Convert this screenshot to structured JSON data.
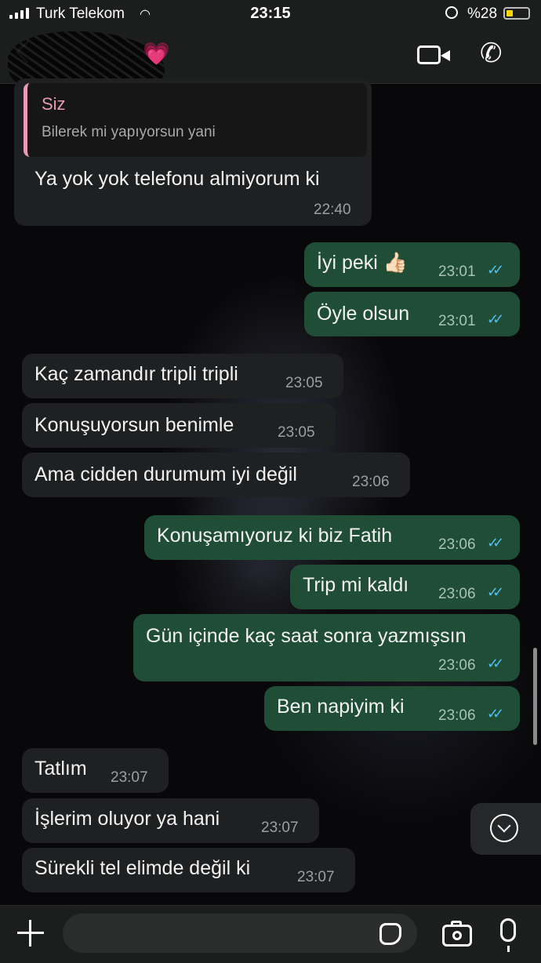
{
  "status_bar": {
    "carrier": "Turk Telekom",
    "time": "23:15",
    "battery_percent": "%28",
    "battery_level": 0.28,
    "battery_color": "#ffd60a"
  },
  "header": {
    "contact_name": "",
    "heart": "💗"
  },
  "messages": [
    {
      "direction": "in",
      "quote_author": "Siz",
      "quote_text": "Bilerek mi yapıyorsun yani",
      "text": "Ya yok yok telefonu almiyorum ki",
      "time": "22:40"
    },
    {
      "direction": "out",
      "text": "İyi peki 👍🏻",
      "time": "23:01",
      "read": true
    },
    {
      "direction": "out",
      "text": "Öyle olsun",
      "time": "23:01",
      "read": true
    },
    {
      "direction": "in",
      "text": "Kaç zamandır tripli tripli",
      "time": "23:05"
    },
    {
      "direction": "in",
      "text": "Konuşuyorsun benimle",
      "time": "23:05"
    },
    {
      "direction": "in",
      "text": "Ama cidden durumum iyi değil",
      "time": "23:06"
    },
    {
      "direction": "out",
      "text": "Konuşamıyoruz ki biz Fatih",
      "time": "23:06",
      "read": true
    },
    {
      "direction": "out",
      "text": "Trip mi kaldı",
      "time": "23:06",
      "read": true
    },
    {
      "direction": "out",
      "text": "Gün içinde kaç saat sonra yazmışsın",
      "time": "23:06",
      "read": true
    },
    {
      "direction": "out",
      "text": "Ben napiyim ki",
      "time": "23:06",
      "read": true
    },
    {
      "direction": "in",
      "text": "Tatlım",
      "time": "23:07"
    },
    {
      "direction": "in",
      "text": "İşlerim oluyor ya hani",
      "time": "23:07"
    },
    {
      "direction": "in",
      "text": "Sürekli tel elimde değil ki",
      "time": "23:07"
    }
  ],
  "composer": {
    "value": "",
    "placeholder": ""
  },
  "colors": {
    "incoming_bubble": "#1f2021",
    "outgoing_bubble": "#1f4d36",
    "read_ticks": "#53bdeb",
    "quote_accent": "#e79bb4"
  },
  "icons": [
    "back-icon",
    "video-call-icon",
    "voice-call-icon",
    "scroll-down-icon",
    "plus-icon",
    "sticker-icon",
    "camera-icon",
    "mic-icon"
  ]
}
